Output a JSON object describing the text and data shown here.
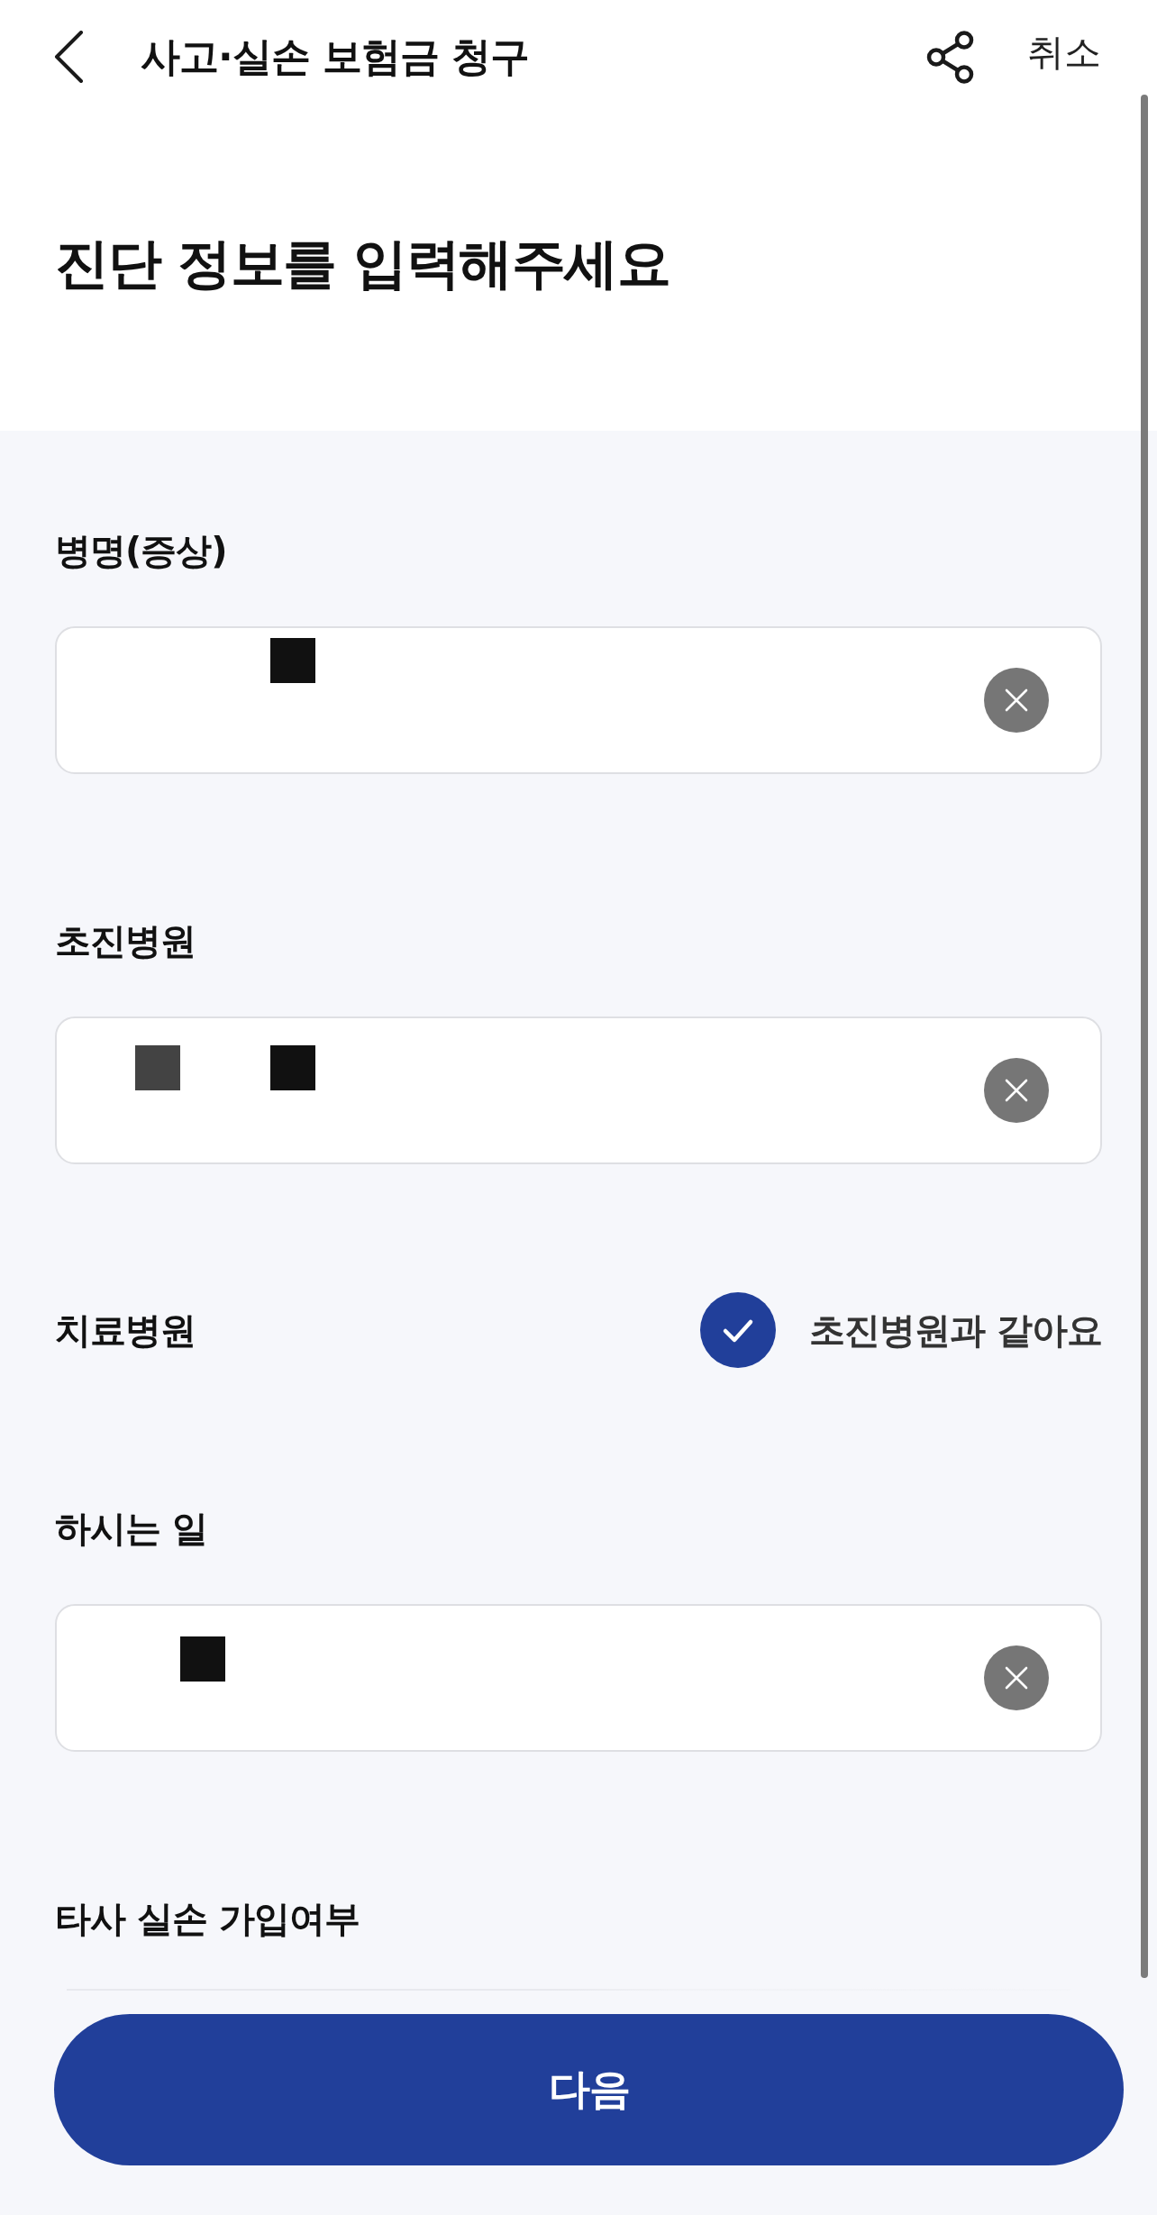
{
  "header": {
    "title": "사고·실손 보험금 청구",
    "cancel_label": "취소"
  },
  "heading": "진단 정보를 입력해주세요",
  "sections": [
    {
      "kind": "input",
      "label": "병명(증상)",
      "redaction": [
        {
          "kind": "gap"
        },
        {
          "kind": "gap"
        },
        {
          "kind": "gap"
        },
        {
          "kind": "gap"
        },
        {
          "kind": "mark",
          "color": "#111111"
        }
      ]
    },
    {
      "kind": "input",
      "label": "초진병원",
      "redaction": [
        {
          "kind": "gap"
        },
        {
          "kind": "mark",
          "color": "#434343"
        },
        {
          "kind": "gap"
        },
        {
          "kind": "gap"
        },
        {
          "kind": "mark",
          "color": "#111111"
        }
      ]
    },
    {
      "kind": "checkbox",
      "label": "치료병원",
      "option": {
        "label": "초진병원과 같아요",
        "checked": true
      }
    },
    {
      "kind": "input",
      "label": "하시는 일",
      "redaction": [
        {
          "kind": "gap"
        },
        {
          "kind": "gap"
        },
        {
          "kind": "mark",
          "color": "#111111"
        }
      ]
    },
    {
      "kind": "partial",
      "label": "타사 실손 가입여부"
    }
  ],
  "next_button": "다음"
}
